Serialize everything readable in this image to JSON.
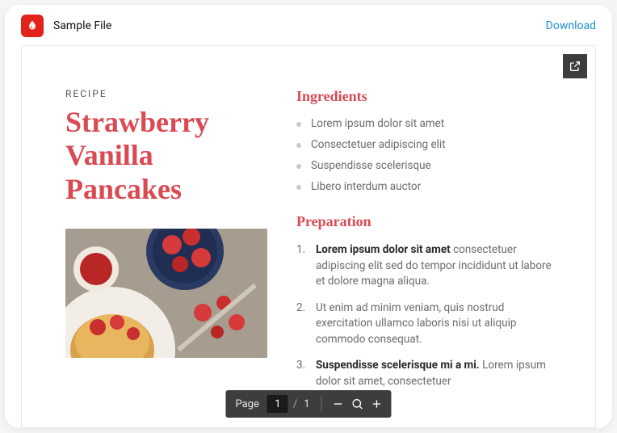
{
  "header": {
    "file_title": "Sample File",
    "download_label": "Download"
  },
  "doc": {
    "kicker": "RECIPE",
    "title": "Strawberry Vanilla Pancakes",
    "ingredients_heading": "Ingredients",
    "ingredients": [
      "Lorem ipsum dolor sit amet",
      "Consectetuer adipiscing elit",
      "Suspendisse scelerisque",
      "Libero interdum auctor"
    ],
    "preparation_heading": "Preparation",
    "steps": [
      {
        "title": "Lorem ipsum dolor sit amet",
        "body": "consectetuer adipiscing elit sed do tempor incididunt ut labore et dolore magna aliqua."
      },
      {
        "title": "",
        "body": "Ut enim ad minim veniam, quis nostrud exercitation ullamco laboris nisi ut aliquip commodo consequat."
      },
      {
        "title": "Suspendisse scelerisque mi a mi.",
        "body": "Lorem ipsum dolor sit amet, consectetuer"
      }
    ]
  },
  "toolbar": {
    "page_label": "Page",
    "current_page": "1",
    "separator": "/",
    "total_pages": "1"
  },
  "colors": {
    "accent": "#d94a52",
    "pdf_red": "#e2231a",
    "link": "#1f8dd6"
  }
}
